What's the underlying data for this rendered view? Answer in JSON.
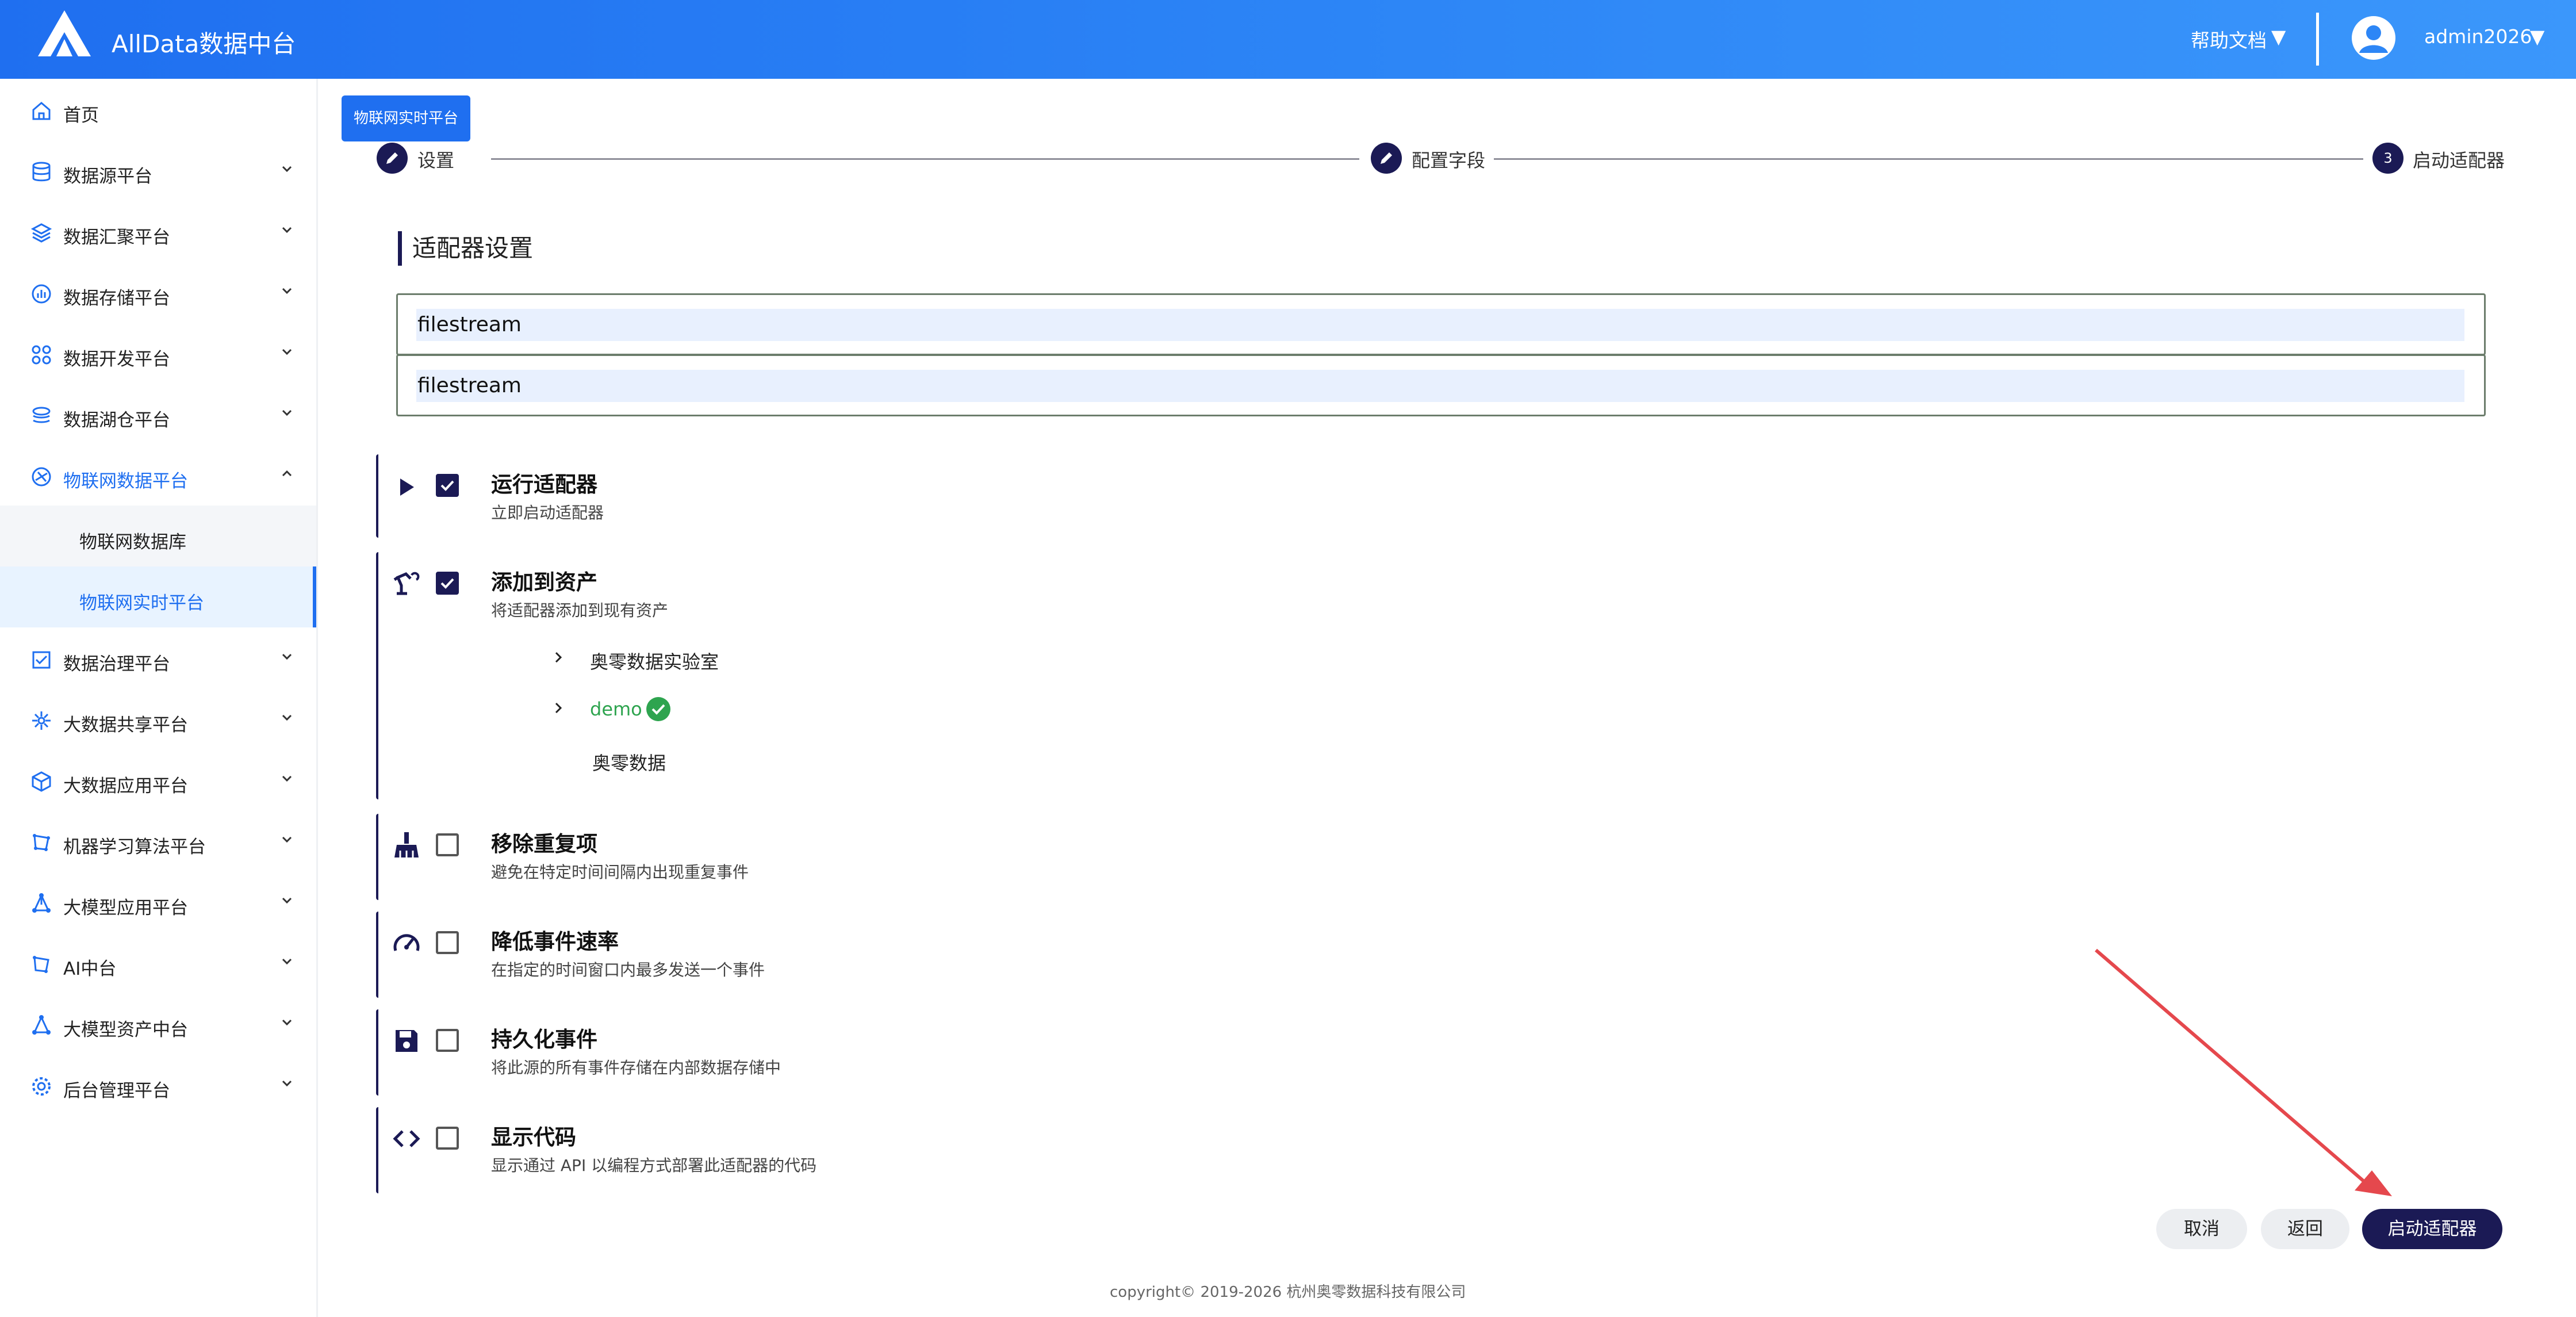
{
  "header": {
    "app_title": "AllData数据中台",
    "help_label": "帮助文档",
    "help_caret": "▼",
    "username": "admin2026",
    "user_caret": "▼"
  },
  "sidebar": {
    "items": [
      {
        "label": "首页",
        "icon": "home-icon"
      },
      {
        "label": "数据源平台",
        "icon": "database-icon"
      },
      {
        "label": "数据汇聚平台",
        "icon": "layers-icon"
      },
      {
        "label": "数据存储平台",
        "icon": "chart-icon"
      },
      {
        "label": "数据开发平台",
        "icon": "apps-icon"
      },
      {
        "label": "数据湖仓平台",
        "icon": "lake-icon"
      },
      {
        "label": "物联网数据平台",
        "icon": "iot-icon"
      },
      {
        "label": "数据治理平台",
        "icon": "checklist-icon"
      },
      {
        "label": "大数据共享平台",
        "icon": "share-icon"
      },
      {
        "label": "大数据应用平台",
        "icon": "cube-icon"
      },
      {
        "label": "机器学习算法平台",
        "icon": "ml-icon"
      },
      {
        "label": "大模型应用平台",
        "icon": "network-icon"
      },
      {
        "label": "AI中台",
        "icon": "ai-icon"
      },
      {
        "label": "大模型资产中台",
        "icon": "asset-icon"
      },
      {
        "label": "后台管理平台",
        "icon": "gear-icon"
      }
    ],
    "subitems": [
      {
        "label": "物联网数据库"
      },
      {
        "label": "物联网实时平台"
      }
    ]
  },
  "page": {
    "tag_label": "物联网实时平台",
    "steps": [
      {
        "label": "设置",
        "marker": ""
      },
      {
        "label": "配置字段",
        "marker": ""
      },
      {
        "label": "启动适配器",
        "marker": "3"
      }
    ],
    "section_title": "适配器设置",
    "fields": [
      {
        "value": "filestream"
      },
      {
        "value": "filestream"
      }
    ],
    "options": [
      {
        "title": "运行适配器",
        "desc": "立即启动适配器",
        "checked": true,
        "icon": "play-icon"
      },
      {
        "title": "添加到资产",
        "desc": "将适配器添加到现有资产",
        "checked": true,
        "icon": "robot-arm-icon"
      },
      {
        "title": "移除重复项",
        "desc": "避免在特定时间间隔内出现重复事件",
        "checked": false,
        "icon": "broom-icon"
      },
      {
        "title": "降低事件速率",
        "desc": "在指定的时间窗口内最多发送一个事件",
        "checked": false,
        "icon": "speedometer-icon"
      },
      {
        "title": "持久化事件",
        "desc": "将此源的所有事件存储在内部数据存储中",
        "checked": false,
        "icon": "save-icon"
      },
      {
        "title": "显示代码",
        "desc": "显示通过 API 以编程方式部署此适配器的代码",
        "checked": false,
        "icon": "code-icon"
      }
    ],
    "tree": [
      {
        "label": "奥零数据实验室"
      },
      {
        "label": "demo"
      },
      {
        "label": "奥零数据"
      }
    ]
  },
  "buttons": {
    "cancel": "取消",
    "back": "返回",
    "start": "启动适配器"
  },
  "footer": {
    "copyright": "copyright© 2019-2026 杭州奥零数据科技有限公司"
  },
  "colors": {
    "header_blue": "#1f6ff0",
    "accent_dark": "#1b1a55",
    "success_green": "#2ea44f",
    "annotation_red": "#e5484d"
  }
}
